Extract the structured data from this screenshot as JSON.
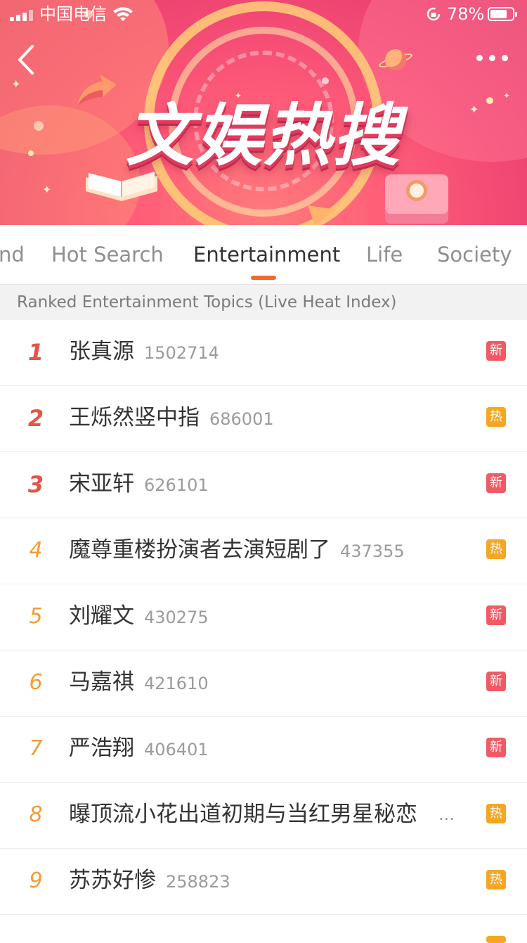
{
  "status_bar": {
    "carrier": "中国电信",
    "battery_percent": "78%",
    "battery_level": 0.78
  },
  "banner": {
    "title": "文娱热搜"
  },
  "tabs": [
    {
      "label": "nd",
      "active": false
    },
    {
      "label": "Hot Search",
      "active": false
    },
    {
      "label": "Entertainment",
      "active": true
    },
    {
      "label": "Life",
      "active": false
    },
    {
      "label": "Society",
      "active": false
    }
  ],
  "subheader": "Ranked Entertainment Topics (Live Heat Index)",
  "colors": {
    "accent": "#f26a2b",
    "rank_top": "#e25548",
    "rank_other": "#f39c34",
    "badge_new": "#f25a63",
    "badge_hot": "#f5a623"
  },
  "items": [
    {
      "rank": "1",
      "title": "张真源",
      "heat": "1502714",
      "badge": "新",
      "badge_type": "new"
    },
    {
      "rank": "2",
      "title": "王烁然竖中指",
      "heat": "686001",
      "badge": "热",
      "badge_type": "hot"
    },
    {
      "rank": "3",
      "title": "宋亚轩",
      "heat": "626101",
      "badge": "新",
      "badge_type": "new"
    },
    {
      "rank": "4",
      "title": "魔尊重楼扮演者去演短剧了",
      "heat": "437355",
      "badge": "热",
      "badge_type": "hot"
    },
    {
      "rank": "5",
      "title": "刘耀文",
      "heat": "430275",
      "badge": "新",
      "badge_type": "new"
    },
    {
      "rank": "6",
      "title": "马嘉祺",
      "heat": "421610",
      "badge": "新",
      "badge_type": "new"
    },
    {
      "rank": "7",
      "title": "严浩翔",
      "heat": "406401",
      "badge": "新",
      "badge_type": "new"
    },
    {
      "rank": "8",
      "title": "曝顶流小花出道初期与当红男星秘恋",
      "heat": "",
      "truncated": "...",
      "badge": "热",
      "badge_type": "hot"
    },
    {
      "rank": "9",
      "title": "苏苏好惨",
      "heat": "258823",
      "badge": "热",
      "badge_type": "hot"
    }
  ]
}
